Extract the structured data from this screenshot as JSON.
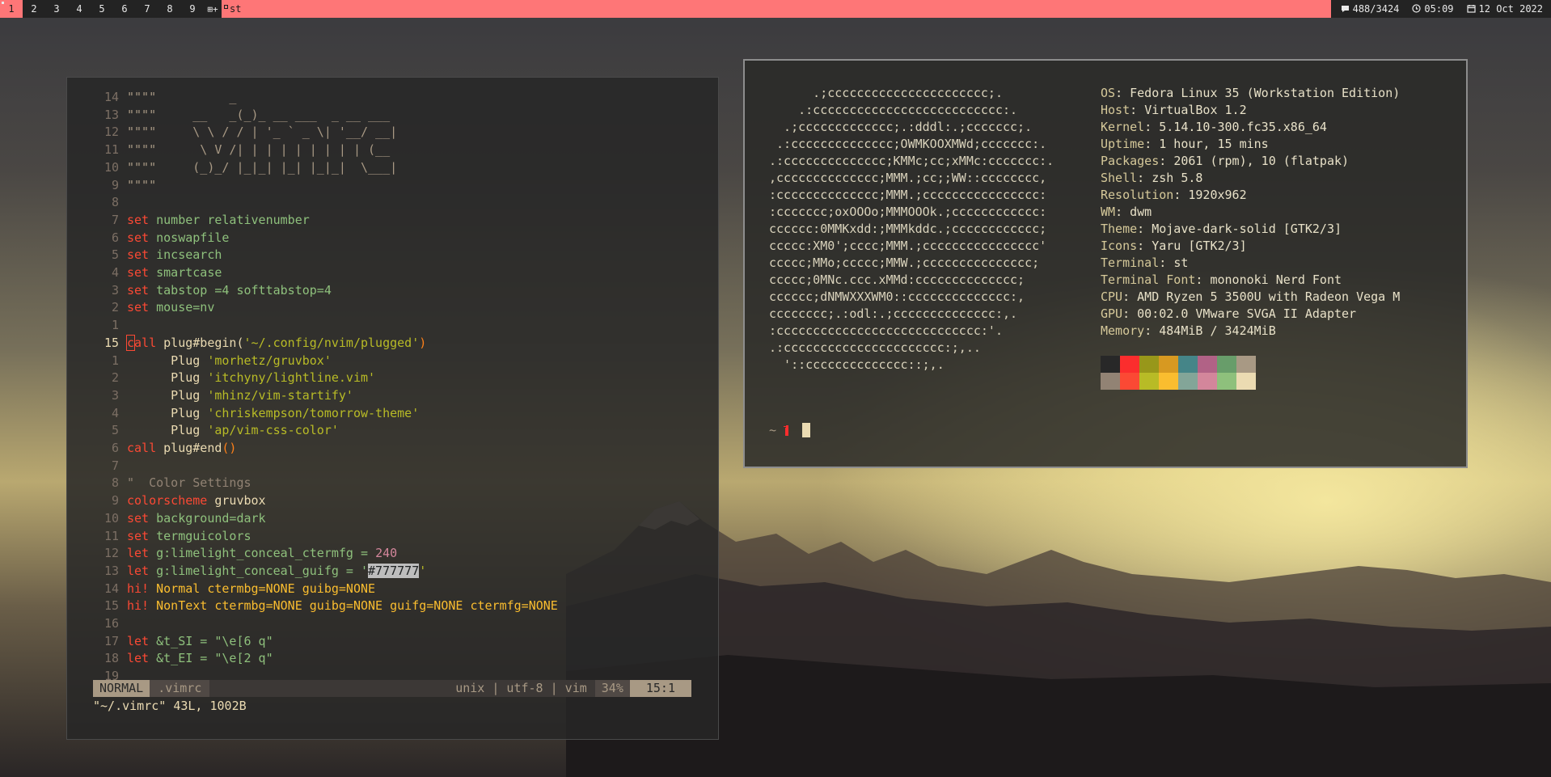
{
  "bar": {
    "tags": [
      "1",
      "2",
      "3",
      "4",
      "5",
      "6",
      "7",
      "8",
      "9"
    ],
    "selected_tag": "1",
    "layout_symbol": "⊞+",
    "window_title": "st",
    "memory": "488/3424",
    "time": "05:09",
    "date": "12 Oct 2022",
    "memory_icon": "speech-bubble-icon",
    "clock_icon": "clock-icon",
    "calendar_icon": "calendar-icon"
  },
  "vim": {
    "lines": [
      {
        "n": "14",
        "t": "\"\"\"\"          _"
      },
      {
        "n": "13",
        "t": "\"\"\"\"     __   _(_)_ __ ___  _ __ ___"
      },
      {
        "n": "12",
        "t": "\"\"\"\"     \\ \\ / / | '_ ` _ \\| '__/ __|"
      },
      {
        "n": "11",
        "t": "\"\"\"\"      \\ V /| | | | | | | | | (__"
      },
      {
        "n": "10",
        "t": "\"\"\"\"     (_)_/ |_|_| |_| |_|_|  \\___|"
      },
      {
        "n": "9",
        "t": "\"\"\"\""
      },
      {
        "n": "8",
        "t": ""
      },
      {
        "n": "7",
        "k": "set",
        "r": " number relativenumber"
      },
      {
        "n": "6",
        "k": "set",
        "r": " noswapfile"
      },
      {
        "n": "5",
        "k": "set",
        "r": " incsearch"
      },
      {
        "n": "4",
        "k": "set",
        "r": " smartcase"
      },
      {
        "n": "3",
        "k": "set",
        "r": " tabstop =4 softtabstop=4"
      },
      {
        "n": "2",
        "k": "set",
        "r": " mouse=nv"
      },
      {
        "n": "1",
        "t": ""
      },
      {
        "n": "15",
        "k": "call",
        "r": " plug#begin(",
        "s": "'~/.config/nvim/plugged'",
        "e": ")",
        "cur": true
      },
      {
        "n": "1",
        "p": "      Plug ",
        "s": "'morhetz/gruvbox'"
      },
      {
        "n": "2",
        "p": "      Plug ",
        "s": "'itchyny/lightline.vim'"
      },
      {
        "n": "3",
        "p": "      Plug ",
        "s": "'mhinz/vim-startify'"
      },
      {
        "n": "4",
        "p": "      Plug ",
        "s": "'chriskempson/tomorrow-theme'"
      },
      {
        "n": "5",
        "p": "      Plug ",
        "s": "'ap/vim-css-color'"
      },
      {
        "n": "6",
        "k": "call",
        "r": " plug#end",
        "e": "()"
      },
      {
        "n": "7",
        "t": ""
      },
      {
        "n": "8",
        "c": "\"  Color Settings"
      },
      {
        "n": "9",
        "k": "colorscheme",
        "r": " gruvbox"
      },
      {
        "n": "10",
        "k": "set",
        "r": " background=dark"
      },
      {
        "n": "11",
        "k": "set",
        "r": " termguicolors"
      },
      {
        "n": "12",
        "k": "let",
        "r": " g:limelight_conceal_ctermfg = ",
        "num": "240"
      },
      {
        "n": "13",
        "k": "let",
        "r": " g:limelight_conceal_guifg = '",
        "h": "#777777",
        "e2": "'"
      },
      {
        "n": "14",
        "k": "hi!",
        "y": " Normal ctermbg=NONE guibg=NONE"
      },
      {
        "n": "15",
        "k": "hi!",
        "y": " NonText ctermbg=NONE guibg=NONE guifg=NONE ctermfg=NONE"
      },
      {
        "n": "16",
        "t": ""
      },
      {
        "n": "17",
        "k": "let",
        "r": " &t_SI = \"\\e[6 q\""
      },
      {
        "n": "18",
        "k": "let",
        "r": " &t_EI = \"\\e[2 q\""
      },
      {
        "n": "19",
        "t": ""
      }
    ],
    "status": {
      "mode": "NORMAL",
      "file": ".vimrc",
      "info": "unix | utf-8 | vim",
      "percent": "34%",
      "position": "15:1"
    },
    "cmdline": "\"~/.vimrc\" 43L, 1002B"
  },
  "neofetch": {
    "logo": "      .;cccccccccccccccccccccc;.\n    .:cccccccccccccccccccccccccc:.\n  .;ccccccccccccc;.:dddl:.;ccccccc;.\n .:cccccccccccccc;OWMKOOXMWd;ccccccc:.\n.:cccccccccccccc;KMMc;cc;xMMc:ccccccc:.\n,cccccccccccccc;MMM.;cc;;WW::cccccccc,\n:cccccccccccccc;MMM.;cccccccccccccccc:\n:ccccccc;oxOOOo;MMMOOOk.;cccccccccccc:\ncccccc:0MMKxdd:;MMMkddc.;cccccccccccc;\nccccc:XM0';cccc;MMM.;cccccccccccccccc'\nccccc;MMo;ccccc;MMW.;ccccccccccccccc;\nccccc;0MNc.ccc.xMMd:cccccccccccccc;\ncccccc;dNMWXXXWM0::cccccccccccccc:,\ncccccccc;.:odl:.;cccccccccccccc:,.\n:cccccccccccccccccccccccccccc:'.\n.:cccccccccccccccccccccc:;,..\n  '::cccccccccccccc::;,.",
    "info": [
      {
        "k": "OS",
        "v": "Fedora Linux 35 (Workstation Edition)"
      },
      {
        "k": "Host",
        "v": "VirtualBox 1.2"
      },
      {
        "k": "Kernel",
        "v": "5.14.10-300.fc35.x86_64"
      },
      {
        "k": "Uptime",
        "v": "1 hour, 15 mins"
      },
      {
        "k": "Packages",
        "v": "2061 (rpm), 10 (flatpak)"
      },
      {
        "k": "Shell",
        "v": "zsh 5.8"
      },
      {
        "k": "Resolution",
        "v": "1920x962"
      },
      {
        "k": "WM",
        "v": "dwm"
      },
      {
        "k": "Theme",
        "v": "Mojave-dark-solid [GTK2/3]"
      },
      {
        "k": "Icons",
        "v": "Yaru [GTK2/3]"
      },
      {
        "k": "Terminal",
        "v": "st"
      },
      {
        "k": "Terminal Font",
        "v": "mononoki Nerd Font"
      },
      {
        "k": "CPU",
        "v": "AMD Ryzen 5 3500U with Radeon Vega M"
      },
      {
        "k": "GPU",
        "v": "00:02.0 VMware SVGA II Adapter"
      },
      {
        "k": "Memory",
        "v": "484MiB / 3424MiB"
      }
    ],
    "palette": [
      "#282828",
      "#fb2d2d",
      "#98971a",
      "#d79921",
      "#458588",
      "#b16286",
      "#689d6a",
      "#a89984",
      "#928374",
      "#fb4934",
      "#b8bb26",
      "#fabd2f",
      "#83a598",
      "#d3869b",
      "#8ec07c",
      "#ebdbb2"
    ],
    "prompt": "~",
    "prompt_icon": "fire-extinguisher-icon"
  }
}
